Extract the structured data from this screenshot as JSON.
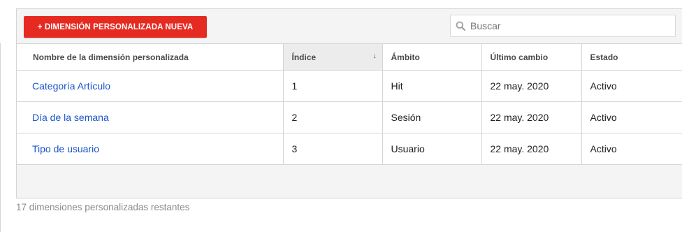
{
  "toolbar": {
    "new_button_label": "+ DIMENSIÓN PERSONALIZADA NUEVA",
    "search_placeholder": "Buscar",
    "search_icon": "search-icon"
  },
  "table": {
    "columns": [
      {
        "label": "Nombre de la dimensión personalizada"
      },
      {
        "label": "Índice",
        "sorted": true,
        "sort_indicator": "↓"
      },
      {
        "label": "Ámbito"
      },
      {
        "label": "Último cambio"
      },
      {
        "label": "Estado"
      }
    ],
    "rows": [
      {
        "name": "Categoría Artículo",
        "index": "1",
        "scope": "Hit",
        "last_change": "22 may. 2020",
        "status": "Activo"
      },
      {
        "name": "Día de la semana",
        "index": "2",
        "scope": "Sesión",
        "last_change": "22 may. 2020",
        "status": "Activo"
      },
      {
        "name": "Tipo de usuario",
        "index": "3",
        "scope": "Usuario",
        "last_change": "22 may. 2020",
        "status": "Activo"
      }
    ]
  },
  "footer": {
    "remaining_text": "17 dimensiones personalizadas restantes"
  },
  "colors": {
    "accent_button": "#e52b21",
    "link": "#1a55c9",
    "border": "#d5d5d5",
    "panel_bg": "#f4f4f4"
  }
}
